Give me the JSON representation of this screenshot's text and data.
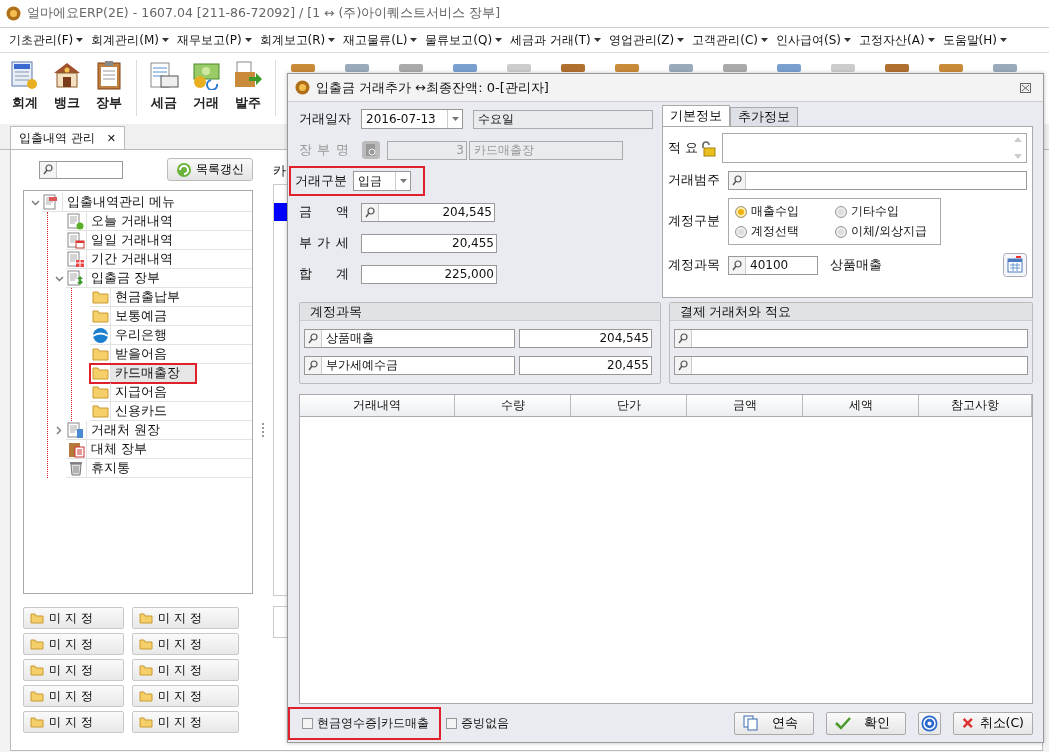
{
  "window": {
    "title": "얼마에요ERP(2E) - 1607.04 [211-86-72092] / [1 ↔ (주)아이퀘스트서비스 장부]"
  },
  "menu": [
    "기초관리(F)",
    "회계관리(M)",
    "재무보고(P)",
    "회계보고(R)",
    "재고물류(L)",
    "물류보고(Q)",
    "세금과 거래(T)",
    "영업관리(Z)",
    "고객관리(C)",
    "인사급여(S)",
    "고정자산(A)",
    "도움말(H)"
  ],
  "toolbar": [
    {
      "label": "회계",
      "kind": "ledger"
    },
    {
      "label": "뱅크",
      "kind": "bank"
    },
    {
      "label": "장부",
      "kind": "clipboard"
    },
    {
      "label": "세금",
      "kind": "tax"
    },
    {
      "label": "거래",
      "kind": "money"
    },
    {
      "label": "발주",
      "kind": "order"
    }
  ],
  "doc_tab": {
    "label": "입출내역 관리",
    "close": "✕",
    "selected": true
  },
  "left_panel": {
    "refresh_button": "목록갱신",
    "tree": [
      {
        "label": "입출내역관리 메뉴",
        "kind": "doc-menu",
        "expanded": true,
        "selected": false,
        "highlighted": false,
        "children": [
          {
            "label": "오늘 거래내역",
            "kind": "doc-today",
            "selected": false,
            "highlighted": false
          },
          {
            "label": "일일 거래내역",
            "kind": "doc-day",
            "selected": false,
            "highlighted": false
          },
          {
            "label": "기간 거래내역",
            "kind": "doc-period",
            "selected": false,
            "highlighted": false
          },
          {
            "label": "입출금 장부",
            "kind": "doc-ledger",
            "expanded": true,
            "selected": false,
            "highlighted": false,
            "children": [
              {
                "label": "현금출납부",
                "kind": "folder",
                "selected": false,
                "highlighted": false
              },
              {
                "label": "보통예금",
                "kind": "folder",
                "selected": false,
                "highlighted": false
              },
              {
                "label": "우리은행",
                "kind": "bank",
                "selected": false,
                "highlighted": false
              },
              {
                "label": "받을어음",
                "kind": "folder",
                "selected": false,
                "highlighted": false
              },
              {
                "label": "카드매출장",
                "kind": "folder",
                "selected": true,
                "highlighted": true
              },
              {
                "label": "지급어음",
                "kind": "folder",
                "selected": false,
                "highlighted": false
              },
              {
                "label": "신용카드",
                "kind": "folder",
                "selected": false,
                "highlighted": false
              }
            ]
          },
          {
            "label": "거래처 원장",
            "kind": "doc-client",
            "expanded": false,
            "selected": false,
            "highlighted": false
          },
          {
            "label": "대체 장부",
            "kind": "clipboard",
            "selected": false,
            "highlighted": false
          },
          {
            "label": "휴지통",
            "kind": "trash",
            "selected": false,
            "highlighted": false
          }
        ]
      }
    ],
    "preset_buttons": [
      "미 지 정",
      "미 지 정",
      "미 지 정",
      "미 지 정",
      "미 지 정",
      "미 지 정",
      "미 지 정",
      "미 지 정",
      "미 지 정",
      "미 지 정"
    ]
  },
  "middle_panel": {
    "heading": "카"
  },
  "dialog": {
    "title": "입출금 거래추가 ↔최종잔액: 0-[관리자]",
    "date": {
      "label": "거래일자",
      "value": "2016-07-13",
      "weekday": "수요일"
    },
    "book": {
      "label": "장 부 명",
      "code": "3",
      "name": "카드매출장",
      "disabled": true
    },
    "type": {
      "label": "거래구분",
      "value": "입금",
      "highlighted": true
    },
    "amount": {
      "label": "금 액",
      "value": "204,545"
    },
    "vat": {
      "label": "부 가 세",
      "value": "20,455"
    },
    "total": {
      "label": "합 계",
      "value": "225,000"
    },
    "tabs": [
      {
        "label": "기본정보",
        "selected": true
      },
      {
        "label": "추가정보",
        "selected": false
      }
    ],
    "memo": {
      "label": "적 요"
    },
    "category": {
      "label": "거래범주"
    },
    "account_type": {
      "label": "계정구분",
      "options": [
        {
          "label": "매출수입",
          "selected": true
        },
        {
          "label": "기타수입",
          "selected": false
        },
        {
          "label": "계정선택",
          "selected": false
        },
        {
          "label": "이체/외상지급",
          "selected": false
        }
      ]
    },
    "account": {
      "label": "계정과목",
      "code": "40100",
      "name": "상품매출"
    },
    "accounts_group": {
      "title": "계정과목",
      "rows": [
        {
          "account": "상품매출",
          "amount": "204,545"
        },
        {
          "account": "부가세예수금",
          "amount": "20,455"
        }
      ]
    },
    "payee_group": {
      "title": "결제 거래처와 적요"
    },
    "table": {
      "columns": [
        "거래내역",
        "수량",
        "단가",
        "금액",
        "세액",
        "참고사항"
      ]
    },
    "checkboxes": [
      {
        "label": "현금영수증|카드매출",
        "checked": false,
        "highlighted": true
      },
      {
        "label": "증빙없음",
        "checked": false,
        "highlighted": false
      }
    ],
    "buttons": [
      {
        "label": "연속",
        "kind": "copy"
      },
      {
        "label": "확인",
        "kind": "check"
      },
      {
        "kind": "help"
      },
      {
        "label": "취소(C)",
        "kind": "cancel"
      }
    ]
  }
}
